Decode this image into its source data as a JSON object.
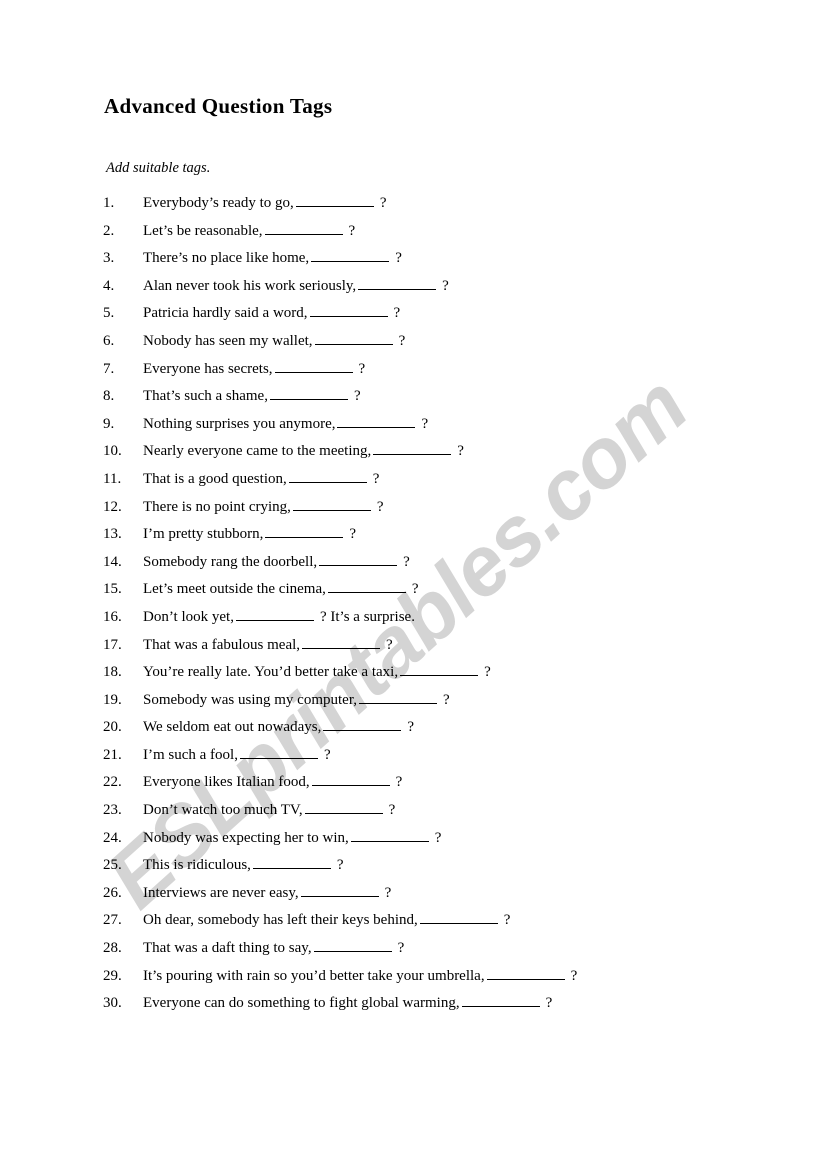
{
  "document": {
    "title": "Advanced Question Tags",
    "instruction": "Add suitable tags.",
    "blank_symbol": "__________",
    "question_mark": "?"
  },
  "watermark": {
    "text": "ESLprintables.com",
    "color": "#d4d4d4"
  },
  "colors": {
    "page_background": "#ffffff",
    "text": "#000000",
    "rule": "#000000"
  },
  "questions": [
    {
      "number": "1.",
      "before": "Everybody’s ready to go,",
      "after": "?"
    },
    {
      "number": "2.",
      "before": "Let’s be reasonable,",
      "after": "?"
    },
    {
      "number": "3.",
      "before": "There’s no place like home,",
      "after": "?"
    },
    {
      "number": "4.",
      "before": "Alan never took his work seriously,",
      "after": "?"
    },
    {
      "number": "5.",
      "before": "Patricia hardly said a word,",
      "after": "?"
    },
    {
      "number": "6.",
      "before": "Nobody has seen my wallet,",
      "after": "?"
    },
    {
      "number": "7.",
      "before": "Everyone has secrets,",
      "after": "?"
    },
    {
      "number": "8.",
      "before": "That’s such a shame,",
      "after": "?"
    },
    {
      "number": "9.",
      "before": "Nothing surprises you anymore,",
      "after": "?"
    },
    {
      "number": "10.",
      "before": "Nearly everyone came to the meeting,",
      "after": "?"
    },
    {
      "number": "11.",
      "before": "That is a good question,",
      "after": "?"
    },
    {
      "number": "12.",
      "before": "There is no point crying,",
      "after": "?"
    },
    {
      "number": "13.",
      "before": "I’m pretty stubborn,",
      "after": "?"
    },
    {
      "number": "14.",
      "before": "Somebody rang the doorbell,",
      "after": "?"
    },
    {
      "number": "15.",
      "before": "Let’s meet outside the cinema,",
      "after": "?"
    },
    {
      "number": "16.",
      "before": "Don’t look yet,",
      "after": "?  It’s a surprise."
    },
    {
      "number": "17.",
      "before": "That was a fabulous meal,",
      "after": "?"
    },
    {
      "number": "18.",
      "before": "You’re really late. You’d better take a taxi,",
      "after": "?"
    },
    {
      "number": "19.",
      "before": "Somebody was using my computer,",
      "after": "?"
    },
    {
      "number": "20.",
      "before": "We seldom eat out nowadays,",
      "after": "?"
    },
    {
      "number": "21.",
      "before": "I’m such a fool,",
      "after": "?"
    },
    {
      "number": "22.",
      "before": "Everyone likes Italian food,",
      "after": "?"
    },
    {
      "number": "23.",
      "before": "Don’t watch too much TV,",
      "after": "?"
    },
    {
      "number": "24.",
      "before": "Nobody was expecting her to win,",
      "after": "?"
    },
    {
      "number": "25.",
      "before": "This is ridiculous,",
      "after": "?"
    },
    {
      "number": "26.",
      "before": "Interviews are never easy,",
      "after": "?"
    },
    {
      "number": "27.",
      "before": "Oh dear, somebody has left their keys behind,",
      "after": "?"
    },
    {
      "number": "28.",
      "before": "That was a daft thing to say,",
      "after": "?"
    },
    {
      "number": "29.",
      "before": "It’s pouring with rain so you’d better take your umbrella,",
      "after": "?"
    },
    {
      "number": "30.",
      "before": "Everyone can do something to fight global warming,",
      "after": "?"
    }
  ]
}
